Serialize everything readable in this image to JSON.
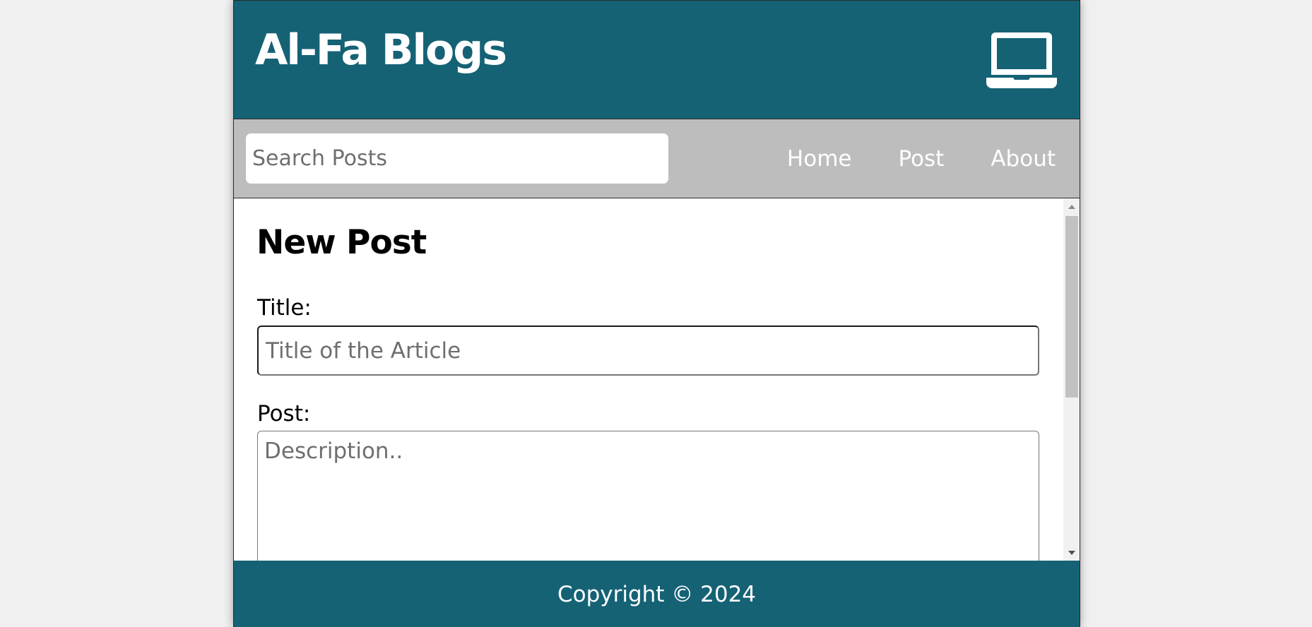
{
  "header": {
    "site_title": "Al-Fa Blogs",
    "icon": "laptop-icon"
  },
  "nav": {
    "search_placeholder": "Search Posts",
    "links": [
      {
        "label": "Home"
      },
      {
        "label": "Post"
      },
      {
        "label": "About"
      }
    ]
  },
  "main": {
    "heading": "New Post",
    "title_label": "Title:",
    "title_placeholder": "Title of the Article",
    "post_label": "Post:",
    "post_placeholder": "Description.."
  },
  "footer": {
    "copyright": "Copyright © 2024"
  },
  "colors": {
    "brand": "#156275",
    "nav_bg": "#bdbdbd",
    "page_bg": "#f0f0f0"
  }
}
